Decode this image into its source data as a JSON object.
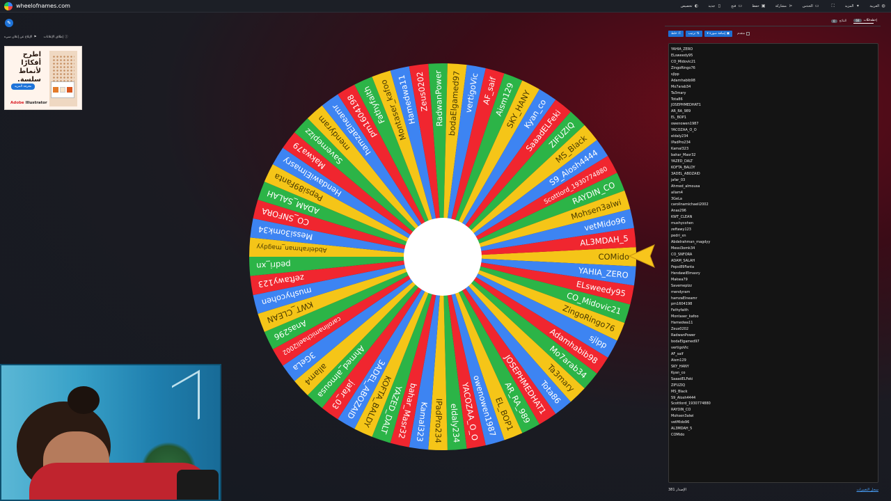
{
  "app": {
    "site": "wheelofnames.com"
  },
  "menu": [
    {
      "label": "العربية",
      "icon": "globe-icon"
    },
    {
      "label": "المزيد",
      "icon": "chevron-down-icon"
    },
    {
      "label": "",
      "icon": "fullscreen-icon"
    },
    {
      "label": "الحدس",
      "icon": "folder-icon"
    },
    {
      "label": "مشاركة",
      "icon": "share-icon"
    },
    {
      "label": "حفظ",
      "icon": "save-icon"
    },
    {
      "label": "فتح",
      "icon": "open-folder-icon"
    },
    {
      "label": "جديد",
      "icon": "new-file-icon"
    },
    {
      "label": "تخصيص",
      "icon": "palette-icon"
    }
  ],
  "left": {
    "links": [
      "إطلاق الإعلانات",
      "الإبلاغ عن إعلان سيء"
    ]
  },
  "ad": {
    "headline": "اطرح أفكارًا لأنماط سلسة.",
    "button": "معرفة المزيد",
    "brand_main": "Adobe",
    "brand_sub": "Illustrator"
  },
  "panel": {
    "tabs": [
      {
        "label": "مدخلات",
        "count": "68"
      },
      {
        "label": "النتائج",
        "count": "0"
      }
    ],
    "hide_label": "إخفاء",
    "toolbar": {
      "shuffle": "خلط",
      "sort": "ترتيب",
      "add_image": "إضافة صورة",
      "advanced": "متقدم"
    },
    "entries": [
      "YAHIA_ZERO",
      "ELsweedy95",
      "CO_Midovic21",
      "ZingoRingo76",
      "sjlpp",
      "Adamhabib98",
      "Mo7arab34",
      "Ta3mary",
      "Tota86",
      "JOSEPHMEDHAT1",
      "AR_RA_989",
      "EL_BOP1",
      "owenowen1987",
      "YACOZAA_O_O",
      "eldaly234",
      "IPadPro234",
      "Kamal323",
      "bahar_Masr32",
      "YAZED_DALT",
      "KOFTA_BALDY",
      "3ADEL_ABOZAID",
      "jafar_03",
      "Ahmed_almousa",
      "allam4",
      "3GeLa",
      "carolinamichaeli2002",
      "Anas296",
      "KWT_CLEAN",
      "mushycohen",
      "zeftawy123",
      "pedri_xn",
      "Abdelrahman_magdyy",
      "Messi3omk34",
      "CO_SNFORA",
      "ADAM_SALAH",
      "Pepsi89Fanta",
      "HendawiElmasry",
      "Makwa79",
      "Savemeplzz",
      "mendyram",
      "hamzaElneamr",
      "pm1604198",
      "Fathyfaith",
      "Montaser_kafoo",
      "Hamedwa11",
      "Zeus0202",
      "RadwanPower",
      "bodaElgamed97",
      "vertigoVic",
      "AF_saif",
      "Aism129",
      "SKY_HANY",
      "Kyan_co",
      "SaaadELFeki",
      "ZIFUZIQ",
      "MS_Black",
      "S9_Alosh4444",
      "Scottlord_1930774880",
      "RAYDIN_CO",
      "Mohsen3alwi",
      "vetMido96",
      "AL3MDAH_5",
      "COMido"
    ],
    "footer_version": "الإصدار 381",
    "footer_link": "سجل التغييرات"
  },
  "wheel": {
    "labels": [
      "COMido",
      "YAHIA_ZERO",
      "ELsweedy95",
      "CO_Midovic21",
      "ZingoRingo76",
      "sjlpp",
      "Adamhabib98",
      "Mo7arab34",
      "Ta3mary",
      "Tota86",
      "JOSEPHMEDHAT1",
      "AR_RA_989",
      "EL_BOP1",
      "owenowen1987",
      "YACOZAA_O_O",
      "eldaly234",
      "IPadPro234",
      "Kamal323",
      "bahar_Masr32",
      "YAZED_DALT",
      "KOFTA_BALDY",
      "3ADEL_ABOZAID",
      "jafar_03",
      "Ahmed_almousa",
      "allam4",
      "3GeLa",
      "carolinamichaeli2002",
      "Anas296",
      "KWT_CLEAN",
      "mushycohen",
      "zeftawy123",
      "pedri_xn",
      "Abdelrahman_magdyy",
      "Messi3omk34",
      "CO_SNFORA",
      "ADAM_SALAH",
      "Pepsi89Fanta",
      "HendawiElmasry",
      "Makwa79",
      "Savemeplzz",
      "mendyram",
      "hamzaElneamr",
      "pm1604198",
      "Fathyfaith",
      "Montaser_kafoo",
      "Hamedwa11",
      "Zeus0202",
      "RadwanPower",
      "bodaElgamed97",
      "vertigoVic",
      "AF_saif",
      "Aism129",
      "SKY_HANY",
      "Kyan_co",
      "SaaadELFeki",
      "ZIFUZIQ",
      "MS_Black",
      "S9_Alosh4444",
      "Scottlord_1930774880",
      "RAYDIN_CO",
      "Mohsen3alwi",
      "vetMido96",
      "AL3MDAH_5"
    ],
    "colors": [
      "#f5c518",
      "#3d84f2",
      "#f0262f",
      "#2cb447"
    ],
    "hub_color": "#ffffff",
    "pointer_color": "#f8c51c"
  }
}
